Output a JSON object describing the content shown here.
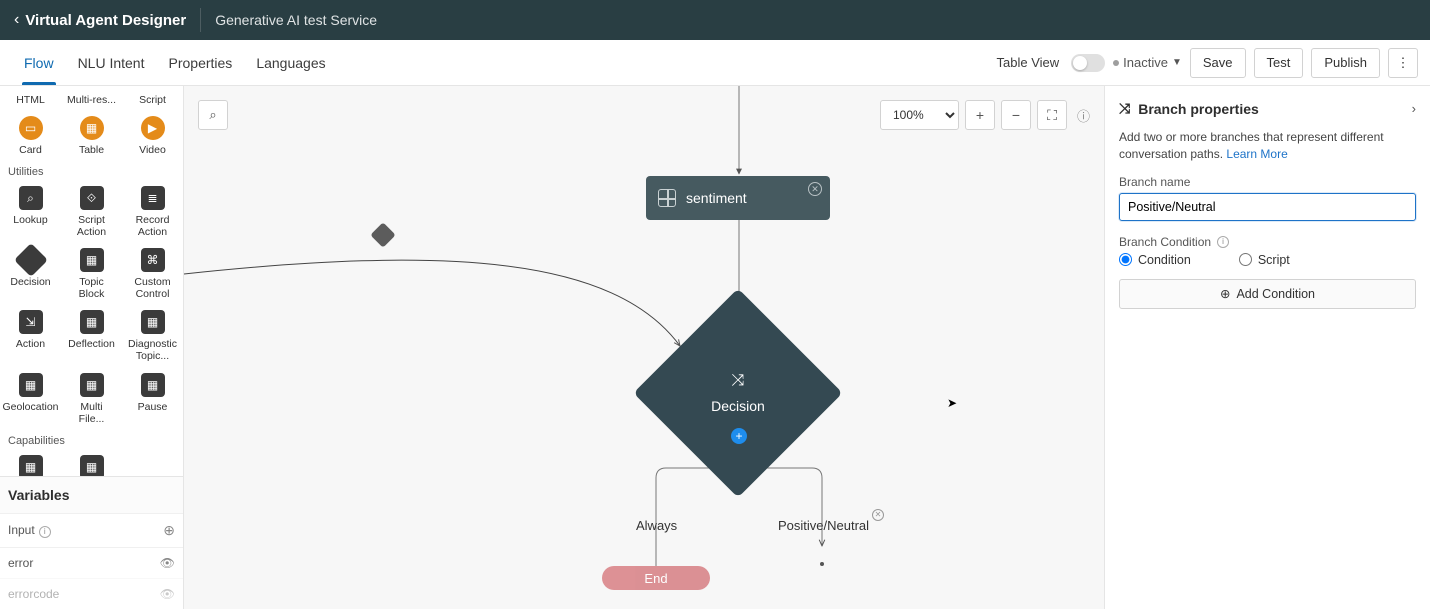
{
  "header": {
    "app_title": "Virtual Agent Designer",
    "service_title": "Generative AI test Service"
  },
  "tabs": {
    "flow": "Flow",
    "nlu": "NLU Intent",
    "properties": "Properties",
    "languages": "Languages"
  },
  "toolbar": {
    "table_view_label": "Table View",
    "status": "Inactive",
    "save": "Save",
    "test": "Test",
    "publish": "Publish"
  },
  "palette": {
    "row_bot": {
      "html": "HTML",
      "multi": "Multi-res...",
      "script": "Script"
    },
    "row_media": {
      "card": "Card",
      "table": "Table",
      "video": "Video"
    },
    "utilities_label": "Utilities",
    "row_u1": {
      "lookup": "Lookup",
      "script_action": "Script\nAction",
      "record_action": "Record\nAction"
    },
    "row_u2": {
      "decision": "Decision",
      "topic_block": "Topic\nBlock",
      "custom_control": "Custom\nControl"
    },
    "row_u3": {
      "action": "Action",
      "deflection": "Deflection",
      "diagnostic": "Diagnostic\nTopic..."
    },
    "row_u4": {
      "geolocation": "Geolocation",
      "multi_file": "Multi\nFile...",
      "pause": "Pause"
    },
    "capabilities_label": "Capabilities",
    "variables_header": "Variables",
    "var_input": "Input",
    "var_error": "error",
    "var_errorcode": "errorcode"
  },
  "canvas": {
    "zoom": "100%",
    "sentiment_label": "sentiment",
    "decision_label": "Decision",
    "branch_always": "Always",
    "branch_positive": "Positive/Neutral",
    "end_label": "End"
  },
  "rpanel": {
    "title": "Branch properties",
    "desc_a": "Add two or more branches that represent different conversation paths. ",
    "learn_more": "Learn More",
    "branch_name_label": "Branch name",
    "branch_name_value": "Positive/Neutral",
    "branch_condition_label": "Branch Condition",
    "opt_condition": "Condition",
    "opt_script": "Script",
    "add_condition": "Add Condition"
  }
}
